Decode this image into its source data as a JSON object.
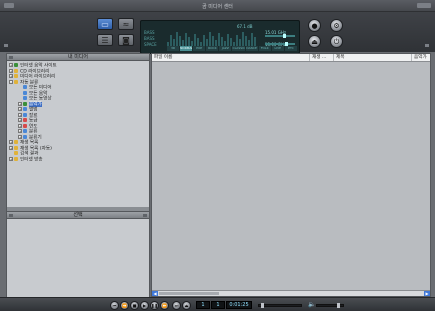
{
  "window": {
    "title": "곰 미디어 센터"
  },
  "player": {
    "display": {
      "labels": [
        "BASS",
        "BASS",
        "SPACE"
      ],
      "peak_text": "67.1 dB",
      "right_lines": [
        "15.01 GHz",
        "15.00 GHz"
      ],
      "modes": [
        {
          "label": "3D",
          "on": false
        },
        {
          "label": "NORMAL",
          "on": true
        },
        {
          "label": "POP",
          "on": false
        },
        {
          "label": "ROCK",
          "on": false
        },
        {
          "label": "JAZZ",
          "on": false
        },
        {
          "label": "CLASSIC",
          "on": false
        },
        {
          "label": "DANCE",
          "on": false
        },
        {
          "label": "FOLK",
          "on": false
        },
        {
          "label": "LIVE",
          "on": false
        },
        {
          "label": "ETC",
          "on": false
        }
      ]
    },
    "left_buttons": [
      "media-view",
      "visual-view",
      "playlist-view",
      "cd-view"
    ],
    "right_buttons": [
      "record",
      "settings",
      "eject",
      "power"
    ]
  },
  "library": {
    "title": "내 미디어",
    "tree": [
      {
        "label": "인터넷 음악 사이트",
        "level": 0,
        "toggle": "+",
        "icon_color": "#3a8f3a",
        "selected": false
      },
      {
        "label": "CD 라이브러리",
        "level": 0,
        "toggle": "+",
        "icon_color": "#e0b23a",
        "selected": false
      },
      {
        "label": "미디어 라이브러리",
        "level": 0,
        "toggle": "+",
        "icon_color": "#e0b23a",
        "selected": false
      },
      {
        "label": "자동 분류",
        "level": 0,
        "toggle": "-",
        "icon_color": "#e0b23a",
        "selected": false
      },
      {
        "label": "모든 미디어",
        "level": 1,
        "toggle": "",
        "icon_color": "#4b88d6",
        "selected": false
      },
      {
        "label": "모든 음악",
        "level": 1,
        "toggle": "",
        "icon_color": "#4b88d6",
        "selected": false
      },
      {
        "label": "모든 동영상",
        "level": 1,
        "toggle": "",
        "icon_color": "#4b88d6",
        "selected": false
      },
      {
        "label": "음악가",
        "level": 1,
        "toggle": "+",
        "icon_color": "#3a8f3a",
        "selected": true
      },
      {
        "label": "앨범",
        "level": 1,
        "toggle": "+",
        "icon_color": "#4b88d6",
        "selected": false
      },
      {
        "label": "장르",
        "level": 1,
        "toggle": "+",
        "icon_color": "#4b88d6",
        "selected": false
      },
      {
        "label": "등급",
        "level": 1,
        "toggle": "+",
        "icon_color": "#d64b4b",
        "selected": false
      },
      {
        "label": "연도",
        "level": 1,
        "toggle": "+",
        "icon_color": "#d64b4b",
        "selected": false
      },
      {
        "label": "분류",
        "level": 1,
        "toggle": "+",
        "icon_color": "#4b88d6",
        "selected": false
      },
      {
        "label": "분류기",
        "level": 1,
        "toggle": "+",
        "icon_color": "#4b88d6",
        "selected": false
      },
      {
        "label": "재생 목록",
        "level": 0,
        "toggle": "+",
        "icon_color": "#e0b23a",
        "selected": false
      },
      {
        "label": "재생 목록 (자동)",
        "level": 0,
        "toggle": "+",
        "icon_color": "#e0b23a",
        "selected": false
      },
      {
        "label": "검색 결과",
        "level": 0,
        "toggle": "",
        "icon_color": "#e0b23a",
        "selected": false
      },
      {
        "label": "인터넷 방송",
        "level": 0,
        "toggle": "+",
        "icon_color": "#e0b23a",
        "selected": false
      }
    ]
  },
  "selection_panel": {
    "title": "선택"
  },
  "list": {
    "columns": [
      {
        "label": "파일 이름"
      },
      {
        "label": "재생 ..."
      },
      {
        "label": "제목"
      },
      {
        "label": "음악가"
      }
    ]
  },
  "transport": {
    "track_index": "1",
    "track_total": "1",
    "time": "0:01:25",
    "buttons": [
      "prev-track",
      "rewind",
      "stop",
      "play",
      "pause",
      "forward",
      "next-track",
      "open"
    ]
  },
  "colors": {
    "accent": "#3f6fc4",
    "display_bg": "#1a2b2d",
    "display_text": "#8fdcdc"
  }
}
